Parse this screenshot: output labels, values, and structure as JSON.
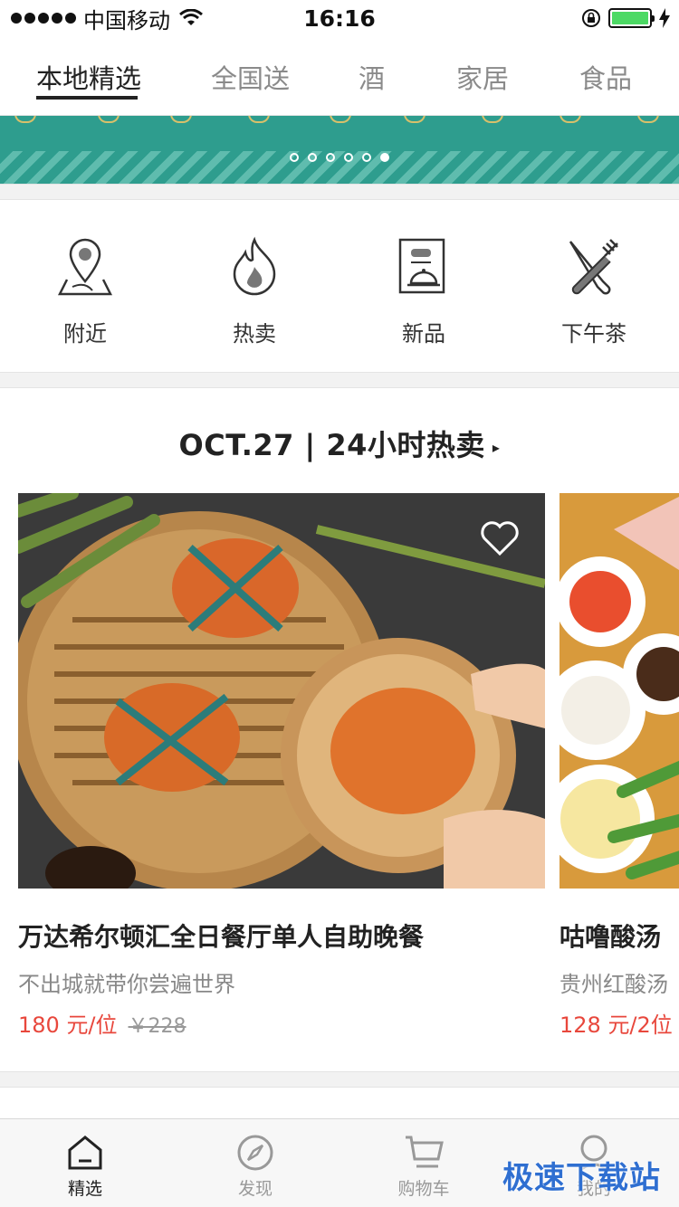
{
  "status_bar": {
    "carrier": "中国移动",
    "time": "16:16"
  },
  "tabs": [
    {
      "label": "本地精选",
      "active": true
    },
    {
      "label": "全国送",
      "active": false
    },
    {
      "label": "酒",
      "active": false
    },
    {
      "label": "家居",
      "active": false
    },
    {
      "label": "食品",
      "active": false
    }
  ],
  "banner": {
    "colors": {
      "background": "#2e9d8e",
      "stripe": "#5fbcae"
    },
    "page_count": 6,
    "active_page": 6
  },
  "categories": [
    {
      "label": "附近",
      "icon": "location-map-icon"
    },
    {
      "label": "热卖",
      "icon": "flame-icon"
    },
    {
      "label": "新品",
      "icon": "menu-cloche-icon"
    },
    {
      "label": "下午茶",
      "icon": "fork-knife-icon"
    }
  ],
  "section": {
    "title": "OCT.27 | 24小时热卖",
    "arrow": "▸"
  },
  "cards": [
    {
      "title": "万达希尔顿汇全日餐厅单人自助晚餐",
      "subtitle": "不出城就带你尝遍世界",
      "price": "180 元/位",
      "original_price": "￥228",
      "image": "crabs-in-bamboo-steamer",
      "favorite_icon": "heart-outline-icon"
    },
    {
      "title": "咕噜酸汤",
      "subtitle": "贵州红酸汤",
      "price": "128 元/2位",
      "image": "hotpot-dishes"
    }
  ],
  "bottom_nav": [
    {
      "label": "精选",
      "icon": "home-icon",
      "active": true
    },
    {
      "label": "发现",
      "icon": "compass-icon",
      "active": false
    },
    {
      "label": "购物车",
      "icon": "cart-icon",
      "active": false
    },
    {
      "label": "我的",
      "icon": "profile-icon",
      "active": false
    }
  ],
  "watermark": "极速下载站",
  "colors": {
    "accent_price": "#e8473c",
    "watermark": "#2f6fd1",
    "battery": "#4cd964"
  }
}
